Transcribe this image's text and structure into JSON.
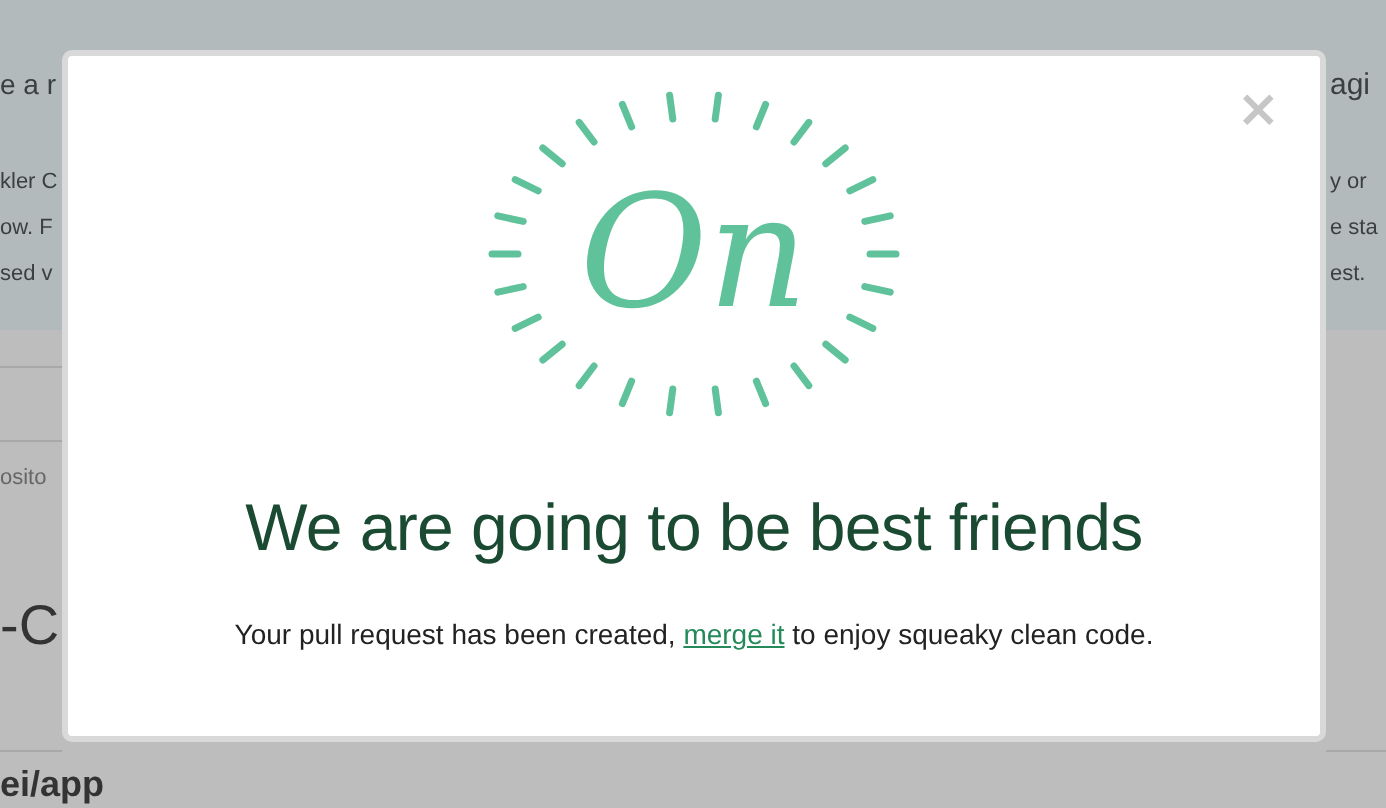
{
  "background": {
    "left": {
      "heading": "e a r",
      "lines": [
        "kler C",
        "ow. F",
        "sed v"
      ],
      "label": "osito",
      "title": "-C"
    },
    "right": {
      "heading": "agi",
      "lines": [
        "y or",
        "e sta",
        "est."
      ]
    },
    "bottom": "ei/app"
  },
  "dialog": {
    "close": "×",
    "logo": "On",
    "title": "We are going to be best friends",
    "message": {
      "before": "Your pull request has been created, ",
      "link": "merge it",
      "after": " to enjoy squeaky clean code."
    }
  }
}
